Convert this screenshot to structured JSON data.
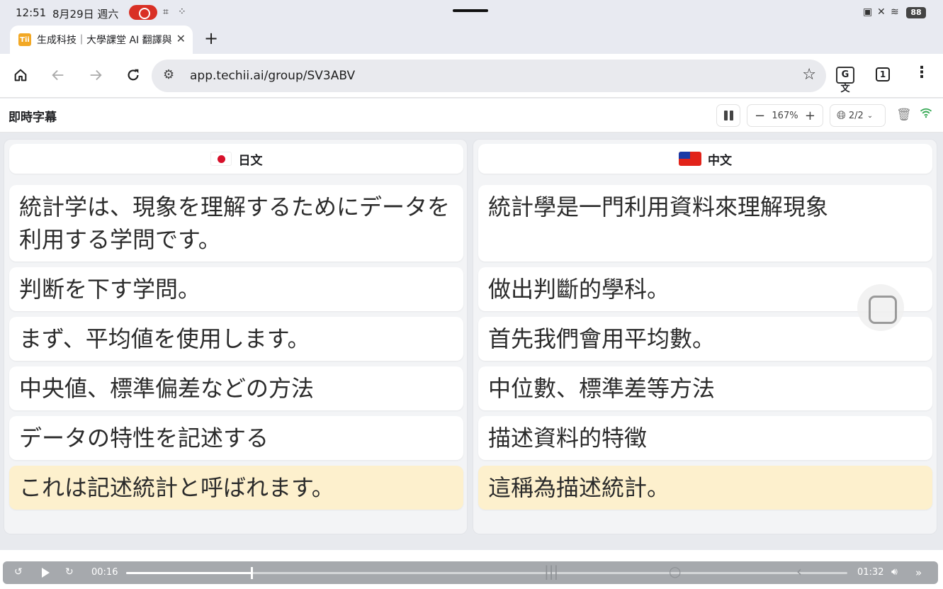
{
  "status_bar": {
    "time": "12:51",
    "date": "8月29日 週六",
    "battery": "88"
  },
  "tab": {
    "favicon_text": "Tii",
    "title": "生成科技｜大學課堂 AI 翻譯與",
    "close": "✕",
    "new_tab": "+"
  },
  "toolbar": {
    "url": "app.techii.ai/group/SV3ABV",
    "tab_count": "1",
    "translate_label": "G文"
  },
  "app": {
    "title": "即時字幕",
    "zoom": "167%",
    "language_count": "2/2"
  },
  "colors": {
    "current_segment": "#fdf0cd",
    "live_indicator": "#34a853",
    "record_pill": "#d93025"
  },
  "panels": {
    "source": {
      "language": "日文",
      "segments": [
        "統計学は、現象を理解するためにデータを利用する学問です。",
        "判断を下す学問。",
        "まず、平均値を使用します。",
        "中央値、標準偏差などの方法",
        "データの特性を記述する",
        "これは記述統計と呼ばれます。"
      ]
    },
    "target": {
      "language": "中文",
      "segments": [
        "統計學是一門利用資料來理解現象",
        "做出判斷的學科。",
        "首先我們會用平均數。",
        "中位數、標準差等方法",
        "描述資料的特徵",
        "這稱為描述統計。"
      ]
    }
  },
  "player": {
    "elapsed": "00:16",
    "duration": "01:32",
    "progress": 0.174
  },
  "icons": [
    "home-icon",
    "back-icon",
    "forward-icon",
    "reload-icon",
    "site-settings-icon",
    "bookmark-star-icon",
    "translate-icon",
    "tab-switcher-icon",
    "menu-icon",
    "pause-icon",
    "zoom-out-icon",
    "zoom-in-icon",
    "globe-icon",
    "chevron-down-icon",
    "trash-icon",
    "wifi-icon",
    "rewind-icon",
    "play-icon",
    "forward-15-icon",
    "volume-icon",
    "fast-forward-icon"
  ]
}
